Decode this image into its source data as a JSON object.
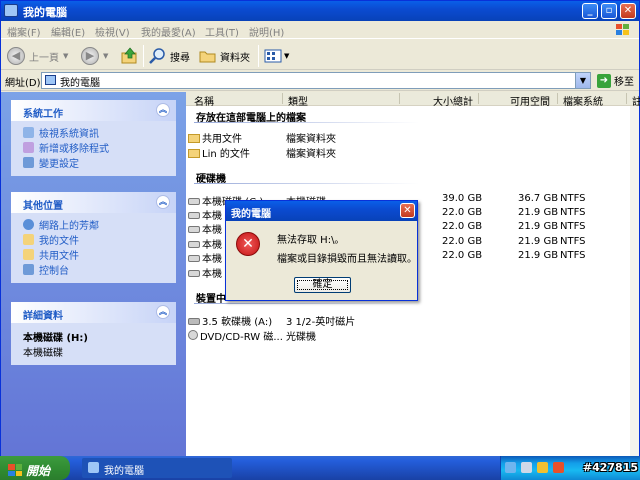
{
  "window": {
    "title": "我的電腦",
    "minimize": "_",
    "maximize": "▫",
    "close": "✕"
  },
  "menu": [
    "檔案(F)",
    "編輯(E)",
    "檢視(V)",
    "我的最愛(A)",
    "工具(T)",
    "說明(H)"
  ],
  "toolbar": {
    "back": "上一頁",
    "search": "搜尋",
    "folders": "資料夾"
  },
  "address": {
    "label": "網址(D)",
    "value": "我的電腦",
    "go": "移至"
  },
  "taskpane": {
    "system_tasks": {
      "title": "系統工作",
      "items": [
        "檢視系統資訊",
        "新增或移除程式",
        "變更設定"
      ]
    },
    "other_places": {
      "title": "其他位置",
      "items": [
        "網路上的芳鄰",
        "我的文件",
        "共用文件",
        "控制台"
      ]
    },
    "details": {
      "title": "詳細資料",
      "name": "本機磁碟 (H:)",
      "type": "本機磁碟"
    }
  },
  "columns": [
    "名稱",
    "類型",
    "大小總計",
    "可用空間",
    "檔案系統",
    "註"
  ],
  "sections": {
    "stored": "存放在這部電腦上的檔案",
    "drives": "硬碟機",
    "removable": "裝置中"
  },
  "stored_files": [
    {
      "name": "共用文件",
      "type": "檔案資料夾"
    },
    {
      "name": "Lin 的文件",
      "type": "檔案資料夾"
    }
  ],
  "drives": [
    {
      "name": "本機磁碟 (C:)",
      "type": "本機磁碟",
      "total": "39.0 GB",
      "free": "36.7 GB",
      "fs": "NTFS"
    },
    {
      "name": "本機",
      "type": "",
      "total": "22.0 GB",
      "free": "21.9 GB",
      "fs": "NTFS"
    },
    {
      "name": "本機",
      "type": "",
      "total": "22.0 GB",
      "free": "21.9 GB",
      "fs": "NTFS"
    },
    {
      "name": "本機",
      "type": "",
      "total": "22.0 GB",
      "free": "21.9 GB",
      "fs": "NTFS"
    },
    {
      "name": "本機",
      "type": "",
      "total": "22.0 GB",
      "free": "21.9 GB",
      "fs": "NTFS"
    },
    {
      "name": "本機",
      "type": "",
      "total": "",
      "free": "",
      "fs": ""
    }
  ],
  "removable": [
    {
      "name": "3.5 軟碟機 (A:)",
      "type": "3 1/2-英吋磁片"
    },
    {
      "name": "DVD/CD-RW 磁...",
      "type": "光碟機"
    }
  ],
  "dialog": {
    "title": "我的電腦",
    "line1": "無法存取 H:\\。",
    "line2": "檔案或目錄損毀而且無法讀取。",
    "ok": "確定"
  },
  "taskbar": {
    "start": "開始",
    "task": "我的電腦",
    "tag": "#427815"
  }
}
